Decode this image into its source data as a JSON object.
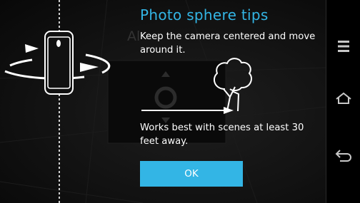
{
  "dialog": {
    "title": "Photo sphere tips",
    "tip_center": "Keep the camera centered and move around it.",
    "tip_scenes": "Works best with scenes at least 30 feet away.",
    "ok_label": "OK"
  },
  "background": {
    "partial_label": "Al"
  },
  "navbar": {
    "buttons": [
      "menu",
      "home",
      "back"
    ]
  },
  "colors": {
    "accent": "#33b5e5",
    "text": "#ffffff",
    "background": "#0c0c0c"
  }
}
